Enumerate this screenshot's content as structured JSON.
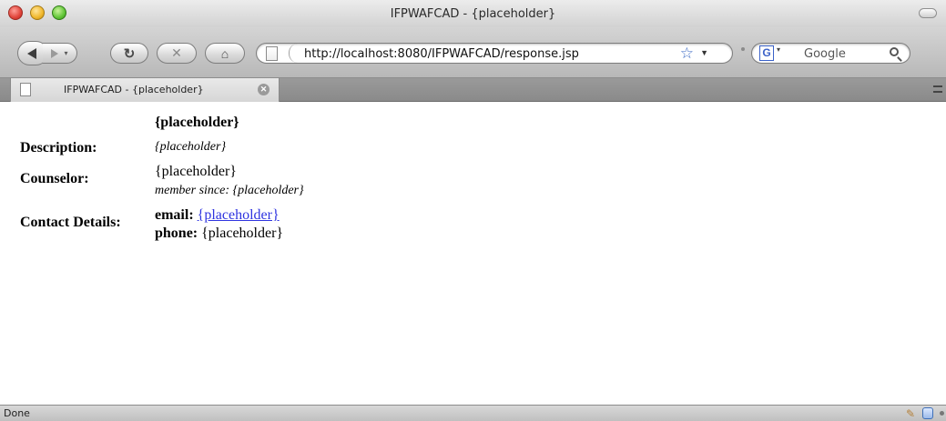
{
  "window": {
    "title": "IFPWAFCAD - {placeholder}"
  },
  "toolbar": {
    "url": "http://localhost:8080/IFPWAFCAD/response.jsp",
    "search_engine_letter": "G",
    "search_placeholder": "Google"
  },
  "tabs": [
    {
      "label": "IFPWAFCAD - {placeholder}"
    }
  ],
  "page": {
    "heading": "{placeholder}",
    "description_label": "Description:",
    "description_value": "{placeholder}",
    "counselor_label": "Counselor:",
    "counselor_name": "{placeholder}",
    "member_since_label": "member since:",
    "member_since_value": "{placeholder}",
    "contact_label": "Contact Details:",
    "email_label": "email:",
    "email_value": "{placeholder}",
    "phone_label": "phone:",
    "phone_value": "{placeholder}"
  },
  "status": {
    "text": "Done"
  },
  "colors": {
    "link": "#2f34e0",
    "star": "#3d6bc4"
  },
  "icons": [
    "back-icon",
    "forward-icon",
    "reload-icon",
    "stop-icon",
    "home-icon",
    "page-icon",
    "bookmark-star-icon",
    "google-icon",
    "search-icon",
    "tab-close-icon"
  ]
}
